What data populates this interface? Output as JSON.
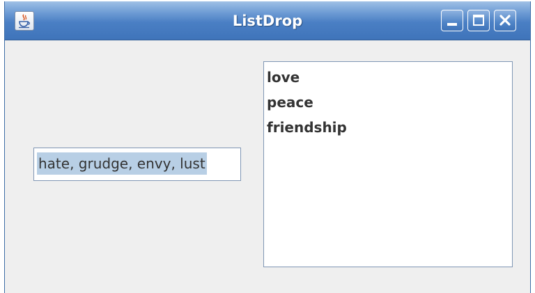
{
  "window": {
    "title": "ListDrop",
    "icon": "java-cup-icon",
    "buttons": {
      "minimize": "minimize-icon",
      "maximize": "maximize-icon",
      "close": "close-icon"
    }
  },
  "text_field": {
    "value": "hate, grudge, envy, lust",
    "selected": true
  },
  "list": {
    "items": [
      "love",
      "peace",
      "friendship"
    ]
  },
  "colors": {
    "titlebar": "#4a7fc4",
    "background": "#efefef",
    "selection": "#b8cfe5",
    "border": "#7f96b4"
  }
}
